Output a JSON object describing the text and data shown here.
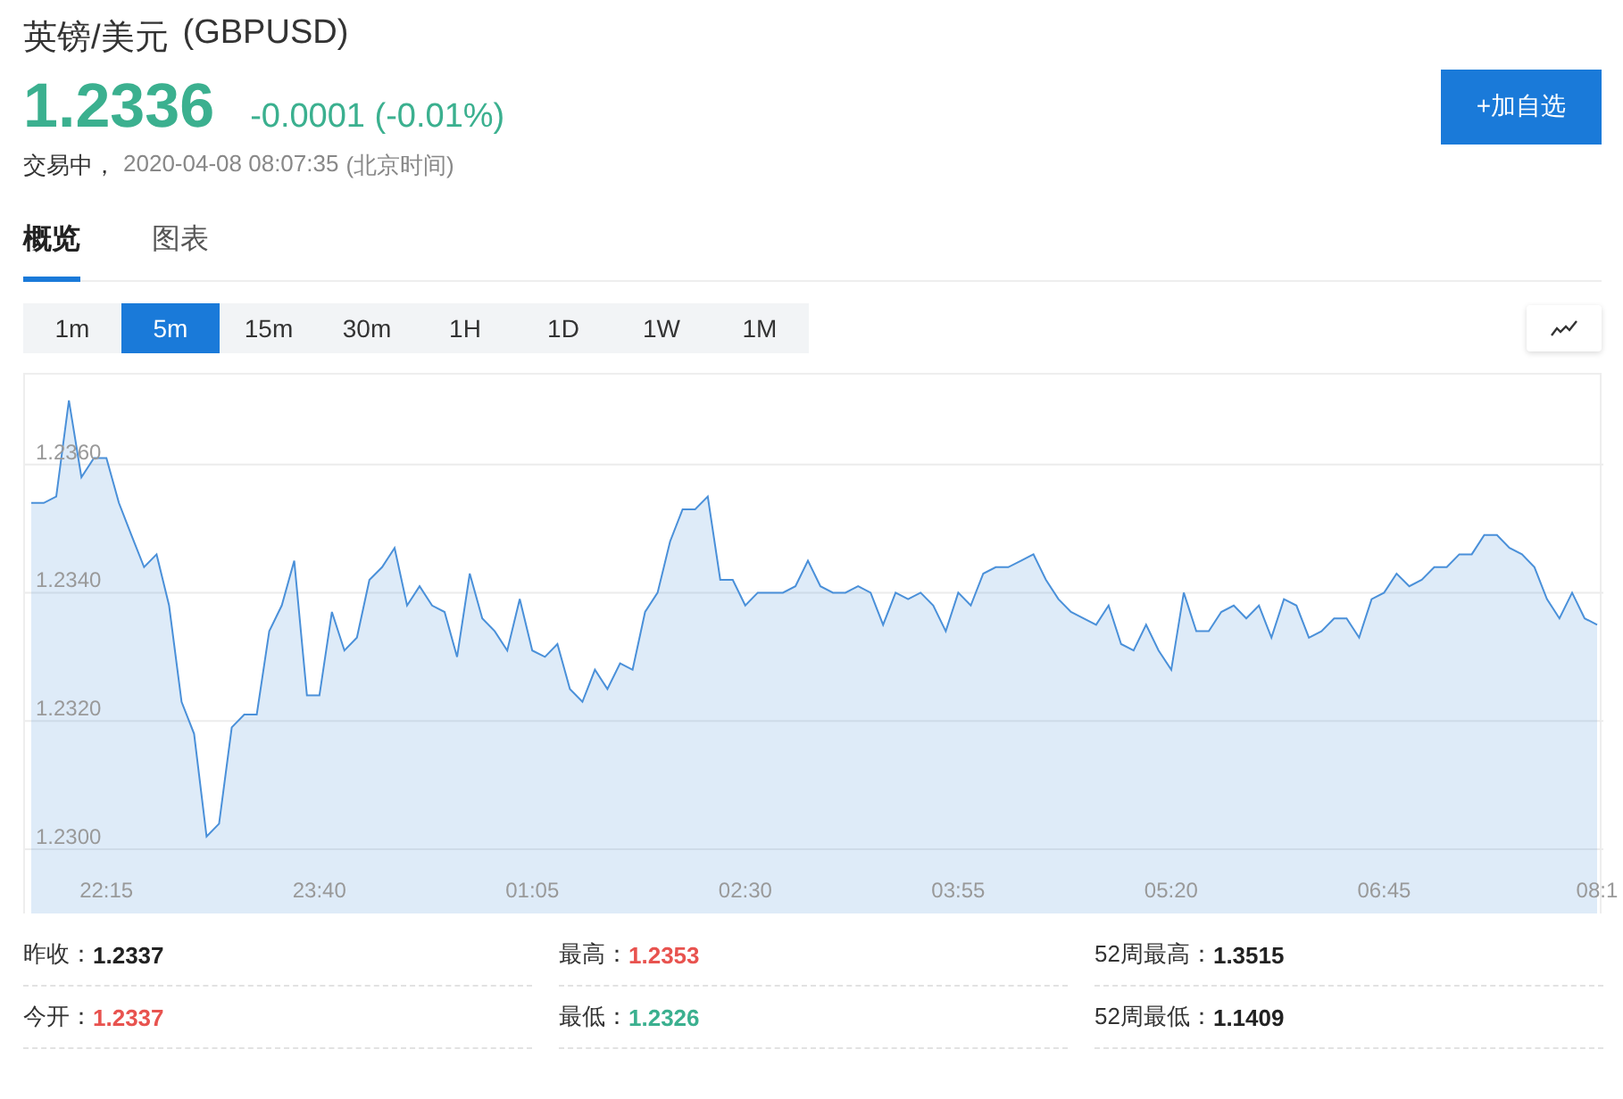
{
  "header": {
    "title": "英镑/美元",
    "symbol": "(GBPUSD)",
    "price": "1.2336",
    "change": "-0.0001 (-0.01%)",
    "status": "交易中，",
    "time": "2020-04-08 08:07:35",
    "timezone": "(北京时间)",
    "watch_button": "+加自选"
  },
  "tabs": [
    {
      "label": "概览",
      "selected": true
    },
    {
      "label": "图表",
      "selected": false
    }
  ],
  "timeframes": [
    {
      "label": "1m",
      "selected": false
    },
    {
      "label": "5m",
      "selected": true
    },
    {
      "label": "15m",
      "selected": false
    },
    {
      "label": "30m",
      "selected": false
    },
    {
      "label": "1H",
      "selected": false
    },
    {
      "label": "1D",
      "selected": false
    },
    {
      "label": "1W",
      "selected": false
    },
    {
      "label": "1M",
      "selected": false
    }
  ],
  "chart": {
    "chart_data": {
      "type": "area",
      "grid": true,
      "categories": [
        null,
        null,
        null,
        null,
        null,
        null,
        "22:15",
        null,
        null,
        null,
        null,
        null,
        null,
        null,
        null,
        null,
        null,
        null,
        null,
        null,
        null,
        null,
        null,
        "23:40",
        null,
        null,
        null,
        null,
        null,
        null,
        null,
        null,
        null,
        null,
        null,
        null,
        null,
        null,
        null,
        null,
        "01:05",
        null,
        null,
        null,
        null,
        null,
        null,
        null,
        null,
        null,
        null,
        null,
        null,
        null,
        null,
        null,
        null,
        "02:30",
        null,
        null,
        null,
        null,
        null,
        null,
        null,
        null,
        null,
        null,
        null,
        null,
        null,
        null,
        null,
        null,
        "03:55",
        null,
        null,
        null,
        null,
        null,
        null,
        null,
        null,
        null,
        null,
        null,
        null,
        null,
        null,
        null,
        null,
        "05:20",
        null,
        null,
        null,
        null,
        null,
        null,
        null,
        null,
        null,
        null,
        null,
        null,
        null,
        null,
        null,
        null,
        "06:45",
        null,
        null,
        null,
        null,
        null,
        null,
        null,
        null,
        null,
        null,
        null,
        null,
        null,
        null,
        null,
        null,
        "08:1"
      ],
      "ylim": [
        1.229,
        1.2374
      ],
      "yticks": [
        {
          "value": 1.23,
          "label": "1.2300"
        },
        {
          "value": 1.232,
          "label": "1.2320"
        },
        {
          "value": 1.234,
          "label": "1.2340"
        },
        {
          "value": 1.236,
          "label": "1.2360"
        }
      ],
      "series": [
        {
          "color": "#4a90d9",
          "values": [
            1.2354,
            1.2354,
            1.2355,
            1.237,
            1.2358,
            1.2361,
            1.2361,
            1.2354,
            1.2349,
            1.2344,
            1.2346,
            1.2338,
            1.2323,
            1.2318,
            1.2302,
            1.2304,
            1.2319,
            1.2321,
            1.2321,
            1.2334,
            1.2338,
            1.2345,
            1.2324,
            1.2324,
            1.2337,
            1.2331,
            1.2333,
            1.2342,
            1.2344,
            1.2347,
            1.2338,
            1.2341,
            1.2338,
            1.2337,
            1.233,
            1.2343,
            1.2336,
            1.2334,
            1.2331,
            1.2339,
            1.2331,
            1.233,
            1.2332,
            1.2325,
            1.2323,
            1.2328,
            1.2325,
            1.2329,
            1.2328,
            1.2337,
            1.234,
            1.2348,
            1.2353,
            1.2353,
            1.2355,
            1.2342,
            1.2342,
            1.2338,
            1.234,
            1.234,
            1.234,
            1.2341,
            1.2345,
            1.2341,
            1.234,
            1.234,
            1.2341,
            1.234,
            1.2335,
            1.234,
            1.2339,
            1.234,
            1.2338,
            1.2334,
            1.234,
            1.2338,
            1.2343,
            1.2344,
            1.2344,
            1.2345,
            1.2346,
            1.2342,
            1.2339,
            1.2337,
            1.2336,
            1.2335,
            1.2338,
            1.2332,
            1.2331,
            1.2335,
            1.2331,
            1.2328,
            1.234,
            1.2334,
            1.2334,
            1.2337,
            1.2338,
            1.2336,
            1.2338,
            1.2333,
            1.2339,
            1.2338,
            1.2333,
            1.2334,
            1.2336,
            1.2336,
            1.2333,
            1.2339,
            1.234,
            1.2343,
            1.2341,
            1.2342,
            1.2344,
            1.2344,
            1.2346,
            1.2346,
            1.2349,
            1.2349,
            1.2347,
            1.2346,
            1.2344,
            1.2339,
            1.2336,
            1.234,
            1.2336,
            1.2335
          ]
        }
      ]
    }
  },
  "stats": [
    {
      "label": "昨收：",
      "value": "1.2337",
      "color": "#222222"
    },
    {
      "label": "最高：",
      "value": "1.2353",
      "color": "#e8534f"
    },
    {
      "label": "52周最高：",
      "value": "1.3515",
      "color": "#222222"
    },
    {
      "label": "今开：",
      "value": "1.2337",
      "color": "#e8534f"
    },
    {
      "label": "最低：",
      "value": "1.2326",
      "color": "#3bb08f"
    },
    {
      "label": "52周最低：",
      "value": "1.1409",
      "color": "#222222"
    }
  ]
}
